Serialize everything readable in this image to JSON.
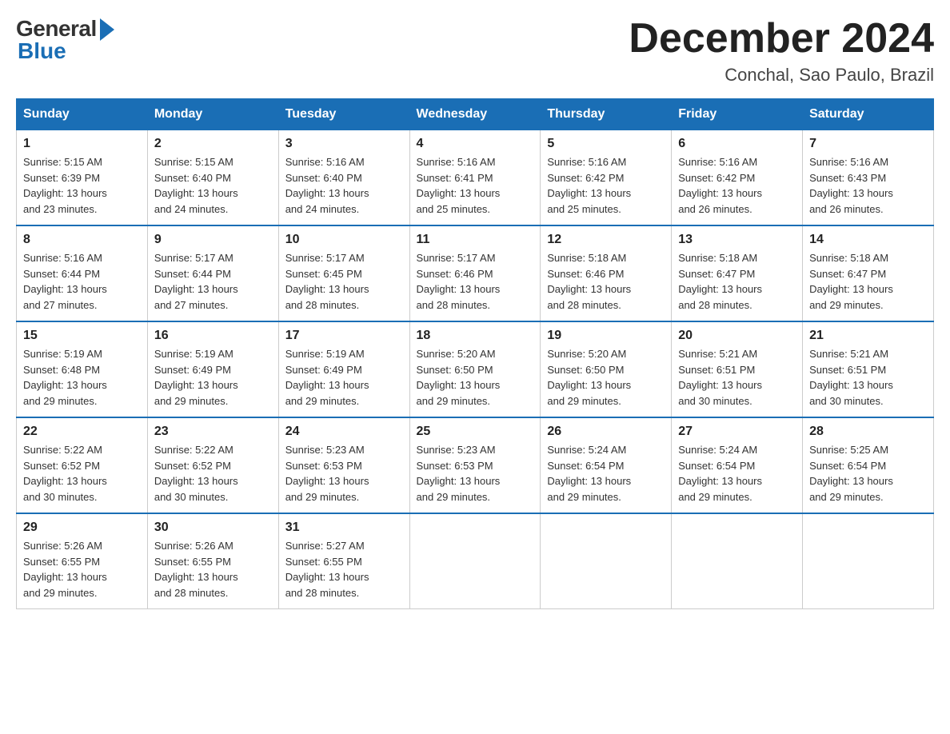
{
  "logo": {
    "general": "General",
    "blue": "Blue"
  },
  "title": "December 2024",
  "location": "Conchal, Sao Paulo, Brazil",
  "days_of_week": [
    "Sunday",
    "Monday",
    "Tuesday",
    "Wednesday",
    "Thursday",
    "Friday",
    "Saturday"
  ],
  "weeks": [
    [
      {
        "day": "1",
        "sunrise": "5:15 AM",
        "sunset": "6:39 PM",
        "daylight": "13 hours and 23 minutes."
      },
      {
        "day": "2",
        "sunrise": "5:15 AM",
        "sunset": "6:40 PM",
        "daylight": "13 hours and 24 minutes."
      },
      {
        "day": "3",
        "sunrise": "5:16 AM",
        "sunset": "6:40 PM",
        "daylight": "13 hours and 24 minutes."
      },
      {
        "day": "4",
        "sunrise": "5:16 AM",
        "sunset": "6:41 PM",
        "daylight": "13 hours and 25 minutes."
      },
      {
        "day": "5",
        "sunrise": "5:16 AM",
        "sunset": "6:42 PM",
        "daylight": "13 hours and 25 minutes."
      },
      {
        "day": "6",
        "sunrise": "5:16 AM",
        "sunset": "6:42 PM",
        "daylight": "13 hours and 26 minutes."
      },
      {
        "day": "7",
        "sunrise": "5:16 AM",
        "sunset": "6:43 PM",
        "daylight": "13 hours and 26 minutes."
      }
    ],
    [
      {
        "day": "8",
        "sunrise": "5:16 AM",
        "sunset": "6:44 PM",
        "daylight": "13 hours and 27 minutes."
      },
      {
        "day": "9",
        "sunrise": "5:17 AM",
        "sunset": "6:44 PM",
        "daylight": "13 hours and 27 minutes."
      },
      {
        "day": "10",
        "sunrise": "5:17 AM",
        "sunset": "6:45 PM",
        "daylight": "13 hours and 28 minutes."
      },
      {
        "day": "11",
        "sunrise": "5:17 AM",
        "sunset": "6:46 PM",
        "daylight": "13 hours and 28 minutes."
      },
      {
        "day": "12",
        "sunrise": "5:18 AM",
        "sunset": "6:46 PM",
        "daylight": "13 hours and 28 minutes."
      },
      {
        "day": "13",
        "sunrise": "5:18 AM",
        "sunset": "6:47 PM",
        "daylight": "13 hours and 28 minutes."
      },
      {
        "day": "14",
        "sunrise": "5:18 AM",
        "sunset": "6:47 PM",
        "daylight": "13 hours and 29 minutes."
      }
    ],
    [
      {
        "day": "15",
        "sunrise": "5:19 AM",
        "sunset": "6:48 PM",
        "daylight": "13 hours and 29 minutes."
      },
      {
        "day": "16",
        "sunrise": "5:19 AM",
        "sunset": "6:49 PM",
        "daylight": "13 hours and 29 minutes."
      },
      {
        "day": "17",
        "sunrise": "5:19 AM",
        "sunset": "6:49 PM",
        "daylight": "13 hours and 29 minutes."
      },
      {
        "day": "18",
        "sunrise": "5:20 AM",
        "sunset": "6:50 PM",
        "daylight": "13 hours and 29 minutes."
      },
      {
        "day": "19",
        "sunrise": "5:20 AM",
        "sunset": "6:50 PM",
        "daylight": "13 hours and 29 minutes."
      },
      {
        "day": "20",
        "sunrise": "5:21 AM",
        "sunset": "6:51 PM",
        "daylight": "13 hours and 30 minutes."
      },
      {
        "day": "21",
        "sunrise": "5:21 AM",
        "sunset": "6:51 PM",
        "daylight": "13 hours and 30 minutes."
      }
    ],
    [
      {
        "day": "22",
        "sunrise": "5:22 AM",
        "sunset": "6:52 PM",
        "daylight": "13 hours and 30 minutes."
      },
      {
        "day": "23",
        "sunrise": "5:22 AM",
        "sunset": "6:52 PM",
        "daylight": "13 hours and 30 minutes."
      },
      {
        "day": "24",
        "sunrise": "5:23 AM",
        "sunset": "6:53 PM",
        "daylight": "13 hours and 29 minutes."
      },
      {
        "day": "25",
        "sunrise": "5:23 AM",
        "sunset": "6:53 PM",
        "daylight": "13 hours and 29 minutes."
      },
      {
        "day": "26",
        "sunrise": "5:24 AM",
        "sunset": "6:54 PM",
        "daylight": "13 hours and 29 minutes."
      },
      {
        "day": "27",
        "sunrise": "5:24 AM",
        "sunset": "6:54 PM",
        "daylight": "13 hours and 29 minutes."
      },
      {
        "day": "28",
        "sunrise": "5:25 AM",
        "sunset": "6:54 PM",
        "daylight": "13 hours and 29 minutes."
      }
    ],
    [
      {
        "day": "29",
        "sunrise": "5:26 AM",
        "sunset": "6:55 PM",
        "daylight": "13 hours and 29 minutes."
      },
      {
        "day": "30",
        "sunrise": "5:26 AM",
        "sunset": "6:55 PM",
        "daylight": "13 hours and 28 minutes."
      },
      {
        "day": "31",
        "sunrise": "5:27 AM",
        "sunset": "6:55 PM",
        "daylight": "13 hours and 28 minutes."
      },
      null,
      null,
      null,
      null
    ]
  ],
  "labels": {
    "sunrise": "Sunrise:",
    "sunset": "Sunset:",
    "daylight": "Daylight:"
  }
}
